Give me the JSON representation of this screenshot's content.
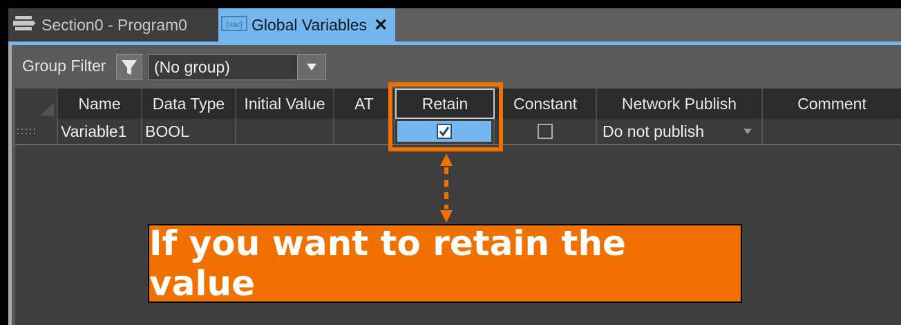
{
  "tabs": {
    "program": {
      "label": "Section0 - Program0",
      "icon": "section-icon"
    },
    "global": {
      "label": "Global Variables",
      "badge": "[var]",
      "icon": "var-icon",
      "close_icon": "close-icon"
    }
  },
  "filter": {
    "label": "Group Filter",
    "selected": "(No group)",
    "icon": "funnel-icon"
  },
  "table": {
    "headers": [
      "Name",
      "Data Type",
      "Initial Value",
      "AT",
      "Retain",
      "Constant",
      "Network Publish",
      "Comment"
    ],
    "rows": [
      {
        "name": "Variable1",
        "data_type": "BOOL",
        "initial_value": "",
        "at": "",
        "retain": true,
        "constant": false,
        "network_publish": "Do not publish",
        "comment": ""
      }
    ]
  },
  "annotation": {
    "callout_text": "If you want to retain the value",
    "color": "#f07000"
  },
  "colors": {
    "accent": "#74b7ee",
    "highlight": "#f07000"
  }
}
